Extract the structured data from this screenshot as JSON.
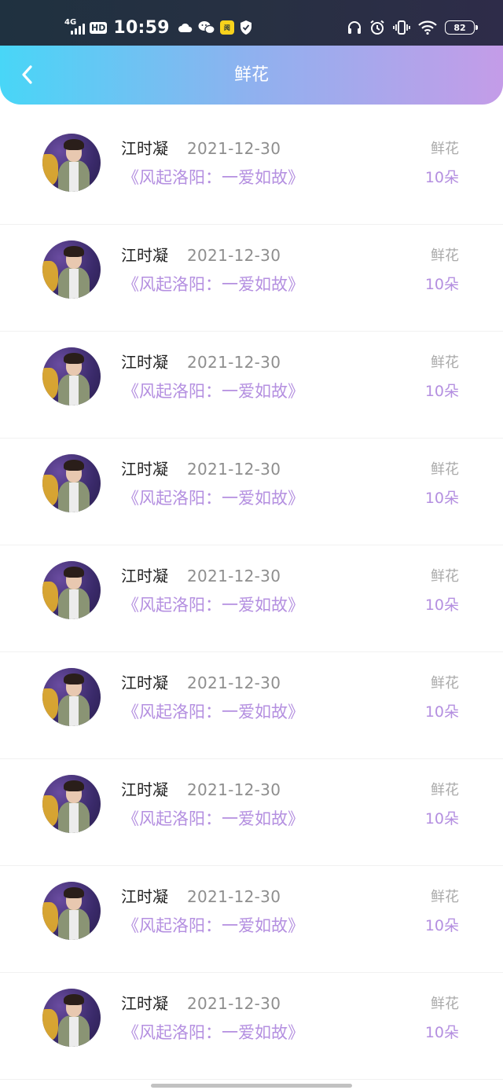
{
  "status_bar": {
    "network": "4G",
    "hd": "HD",
    "time": "10:59",
    "yellow_app_label": "阅",
    "battery": "82"
  },
  "header": {
    "title": "鲜花"
  },
  "items": [
    {
      "name": "江时凝",
      "date": "2021-12-30",
      "drama": "《风起洛阳：一爱如故》",
      "gift_type": "鲜花",
      "gift_count": "10朵"
    },
    {
      "name": "江时凝",
      "date": "2021-12-30",
      "drama": "《风起洛阳：一爱如故》",
      "gift_type": "鲜花",
      "gift_count": "10朵"
    },
    {
      "name": "江时凝",
      "date": "2021-12-30",
      "drama": "《风起洛阳：一爱如故》",
      "gift_type": "鲜花",
      "gift_count": "10朵"
    },
    {
      "name": "江时凝",
      "date": "2021-12-30",
      "drama": "《风起洛阳：一爱如故》",
      "gift_type": "鲜花",
      "gift_count": "10朵"
    },
    {
      "name": "江时凝",
      "date": "2021-12-30",
      "drama": "《风起洛阳：一爱如故》",
      "gift_type": "鲜花",
      "gift_count": "10朵"
    },
    {
      "name": "江时凝",
      "date": "2021-12-30",
      "drama": "《风起洛阳：一爱如故》",
      "gift_type": "鲜花",
      "gift_count": "10朵"
    },
    {
      "name": "江时凝",
      "date": "2021-12-30",
      "drama": "《风起洛阳：一爱如故》",
      "gift_type": "鲜花",
      "gift_count": "10朵"
    },
    {
      "name": "江时凝",
      "date": "2021-12-30",
      "drama": "《风起洛阳：一爱如故》",
      "gift_type": "鲜花",
      "gift_count": "10朵"
    },
    {
      "name": "江时凝",
      "date": "2021-12-30",
      "drama": "《风起洛阳：一爱如故》",
      "gift_type": "鲜花",
      "gift_count": "10朵"
    }
  ],
  "colors": {
    "accent_purple": "#b48fe0",
    "header_gradient_start": "#48d6f7",
    "header_gradient_end": "#c49ce8"
  }
}
